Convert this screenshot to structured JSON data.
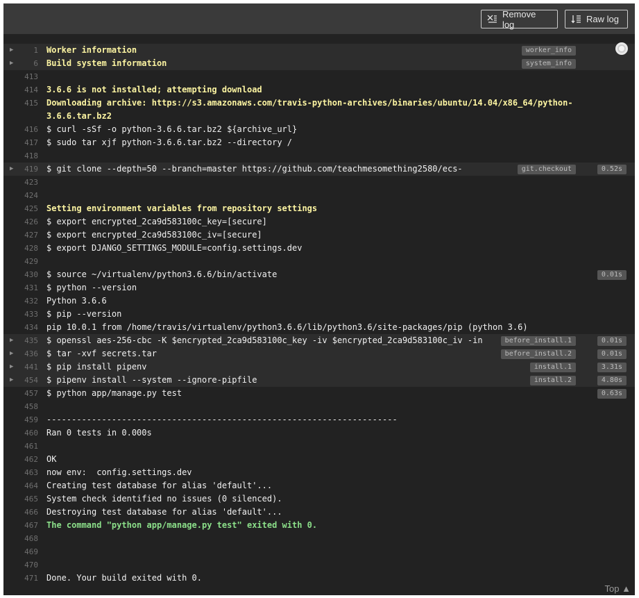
{
  "toolbar": {
    "remove_log": "Remove log",
    "raw_log": "Raw log"
  },
  "top_link": "Top ▲",
  "lines": [
    {
      "n": "1",
      "t": "Worker information",
      "style": "yellow",
      "fold": true,
      "tag": "worker_info",
      "circle": true
    },
    {
      "n": "6",
      "t": "Build system information",
      "style": "yellow",
      "fold": true,
      "tag": "system_info"
    },
    {
      "n": "413",
      "t": ""
    },
    {
      "n": "414",
      "t": "3.6.6 is not installed; attempting download",
      "style": "yellow"
    },
    {
      "n": "415",
      "t": "Downloading archive: https://s3.amazonaws.com/travis-python-archives/binaries/ubuntu/14.04/x86_64/python-3.6.6.tar.bz2",
      "style": "yellow",
      "tall": true
    },
    {
      "n": "416",
      "t": "$ curl -sSf -o python-3.6.6.tar.bz2 ${archive_url}"
    },
    {
      "n": "417",
      "t": "$ sudo tar xjf python-3.6.6.tar.bz2 --directory /"
    },
    {
      "n": "418",
      "t": ""
    },
    {
      "n": "419",
      "t": "$ git clone --depth=50 --branch=master https://github.com/teachmesomething2580/ecs-",
      "fold": true,
      "tag": "git.checkout",
      "time": "0.52s"
    },
    {
      "n": "423",
      "t": ""
    },
    {
      "n": "424",
      "t": ""
    },
    {
      "n": "425",
      "t": "Setting environment variables from repository settings",
      "style": "yellow"
    },
    {
      "n": "426",
      "t": "$ export encrypted_2ca9d583100c_key=[secure]"
    },
    {
      "n": "427",
      "t": "$ export encrypted_2ca9d583100c_iv=[secure]"
    },
    {
      "n": "428",
      "t": "$ export DJANGO_SETTINGS_MODULE=config.settings.dev"
    },
    {
      "n": "429",
      "t": ""
    },
    {
      "n": "430",
      "t": "$ source ~/virtualenv/python3.6.6/bin/activate",
      "time": "0.01s"
    },
    {
      "n": "431",
      "t": "$ python --version"
    },
    {
      "n": "432",
      "t": "Python 3.6.6"
    },
    {
      "n": "433",
      "t": "$ pip --version"
    },
    {
      "n": "434",
      "t": "pip 10.0.1 from /home/travis/virtualenv/python3.6.6/lib/python3.6/site-packages/pip (python 3.6)"
    },
    {
      "n": "435",
      "t": "$ openssl aes-256-cbc -K $encrypted_2ca9d583100c_key -iv $encrypted_2ca9d583100c_iv -in",
      "fold": true,
      "tag": "before_install.1",
      "time": "0.01s"
    },
    {
      "n": "436",
      "t": "$ tar -xvf secrets.tar",
      "fold": true,
      "tag": "before_install.2",
      "time": "0.01s"
    },
    {
      "n": "441",
      "t": "$ pip install pipenv",
      "fold": true,
      "tag": "install.1",
      "time": "3.31s"
    },
    {
      "n": "454",
      "t": "$ pipenv install --system --ignore-pipfile",
      "fold": true,
      "tag": "install.2",
      "time": "4.80s"
    },
    {
      "n": "457",
      "t": "$ python app/manage.py test",
      "time": "0.63s"
    },
    {
      "n": "458",
      "t": ""
    },
    {
      "n": "459",
      "t": "----------------------------------------------------------------------"
    },
    {
      "n": "460",
      "t": "Ran 0 tests in 0.000s"
    },
    {
      "n": "461",
      "t": ""
    },
    {
      "n": "462",
      "t": "OK"
    },
    {
      "n": "463",
      "t": "now env:  config.settings.dev"
    },
    {
      "n": "464",
      "t": "Creating test database for alias 'default'..."
    },
    {
      "n": "465",
      "t": "System check identified no issues (0 silenced)."
    },
    {
      "n": "466",
      "t": "Destroying test database for alias 'default'..."
    },
    {
      "n": "467",
      "t": "The command \"python app/manage.py test\" exited with 0.",
      "style": "green"
    },
    {
      "n": "468",
      "t": ""
    },
    {
      "n": "469",
      "t": ""
    },
    {
      "n": "470",
      "t": ""
    },
    {
      "n": "471",
      "t": "Done. Your build exited with 0."
    }
  ]
}
